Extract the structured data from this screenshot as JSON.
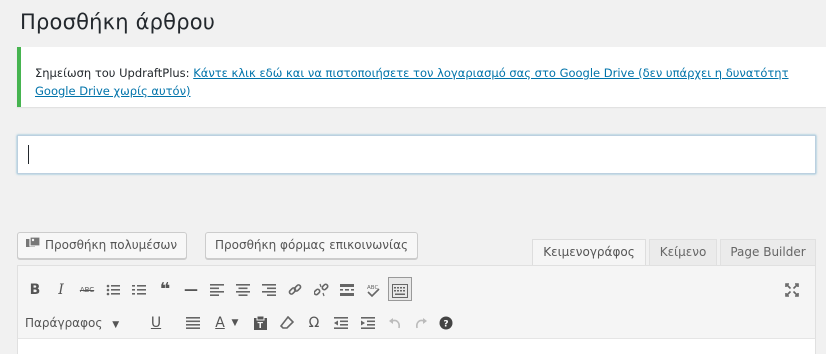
{
  "page": {
    "title": "Προσθήκη άρθρου"
  },
  "notice": {
    "label": "Σημείωση του UpdraftPlus:",
    "link_line1": "Κάντε κλικ εδώ και να πιστοποιήσετε τον λογαριασμό σας στο Google Drive (δεν υπάρχει η δυνατότητ",
    "link_line2": "Google Drive χωρίς αυτόν)",
    "accent_color": "#46b450"
  },
  "title_input": {
    "value": "",
    "placeholder": ""
  },
  "buttons": {
    "add_media": "Προσθήκη πολυμέσων",
    "add_form": "Προσθήκη φόρμας επικοινωνίας"
  },
  "tabs": [
    {
      "label": "Κειμενογράφος",
      "active": true
    },
    {
      "label": "Κείμενο",
      "active": false
    },
    {
      "label": "Page Builder",
      "active": false
    }
  ],
  "toolbar": {
    "bold": "B",
    "italic": "I",
    "strike": "ABC",
    "blockquote": "❝",
    "hr": "—",
    "format_select": "Παράγραφος",
    "underline": "U",
    "text_color": "A",
    "omega": "Ω",
    "help": "?"
  },
  "icons": [
    "media-icon",
    "bold-icon",
    "italic-icon",
    "strikethrough-icon",
    "bullet-list-icon",
    "numbered-list-icon",
    "blockquote-icon",
    "horizontal-rule-icon",
    "align-left-icon",
    "align-center-icon",
    "align-right-icon",
    "link-icon",
    "unlink-icon",
    "read-more-icon",
    "spellcheck-icon",
    "toolbar-toggle-icon",
    "fullscreen-icon",
    "underline-icon",
    "justify-icon",
    "text-color-icon",
    "paste-text-icon",
    "clear-formatting-icon",
    "special-character-icon",
    "outdent-icon",
    "indent-icon",
    "undo-icon",
    "redo-icon",
    "help-icon"
  ]
}
